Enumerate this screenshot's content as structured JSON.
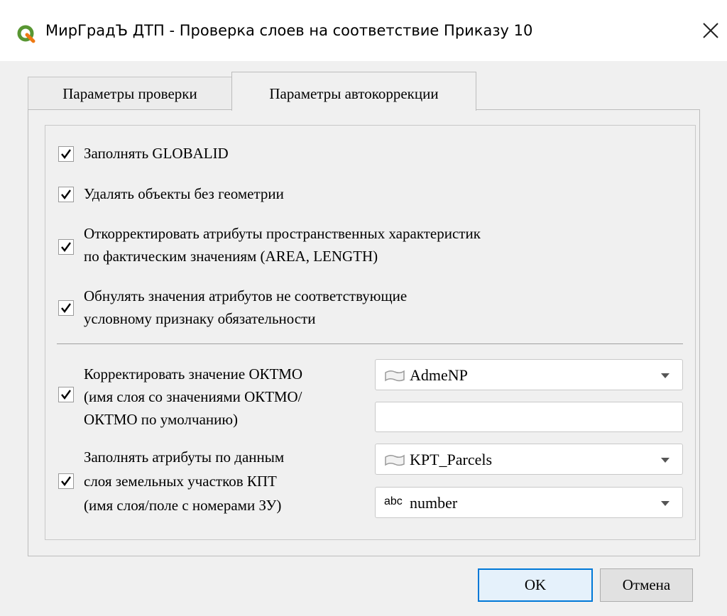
{
  "window": {
    "title": "МирГрадЪ ДТП - Проверка слоев на соответствие Приказу 10",
    "icon": "qgis-logo-icon",
    "close_icon": "close-icon",
    "accent_color": "#0078d7",
    "icon_color": "#589632"
  },
  "tabs": [
    {
      "label": "Параметры проверки",
      "active": false
    },
    {
      "label": "Параметры автокоррекции",
      "active": true
    }
  ],
  "options": [
    {
      "lines": [
        "Заполнять GLOBALID"
      ],
      "checked": true
    },
    {
      "lines": [
        "Удалять объекты без геометрии"
      ],
      "checked": true
    },
    {
      "lines": [
        "Откорректировать атрибуты пространственных характеристик",
        "по фактическим значениям (AREA, LENGTH)"
      ],
      "checked": true
    },
    {
      "lines": [
        "Обнулять значения атрибутов не соответствующие",
        "условному признаку обязательности"
      ],
      "checked": true
    }
  ],
  "oktmo": {
    "checked": true,
    "lines": [
      "Корректировать значение ОКТМО",
      "(имя слоя со значениями ОКТМО/",
      "ОКТМО по умолчанию)"
    ],
    "layer_combo": {
      "value": "AdmeNP",
      "icon": "polygon-layer-icon"
    },
    "default_value": ""
  },
  "parcels": {
    "checked": true,
    "lines": [
      "Заполнять атрибуты по данным",
      "слоя земельных участков КПТ",
      "(имя слоя/поле с номерами ЗУ)"
    ],
    "layer_combo": {
      "value": "KPT_Parcels",
      "icon": "polygon-layer-icon"
    },
    "field_combo": {
      "value": "number",
      "type_label": "abc",
      "icon": "text-field-icon"
    }
  },
  "buttons": {
    "ok": "OK",
    "cancel": "Отмена"
  }
}
